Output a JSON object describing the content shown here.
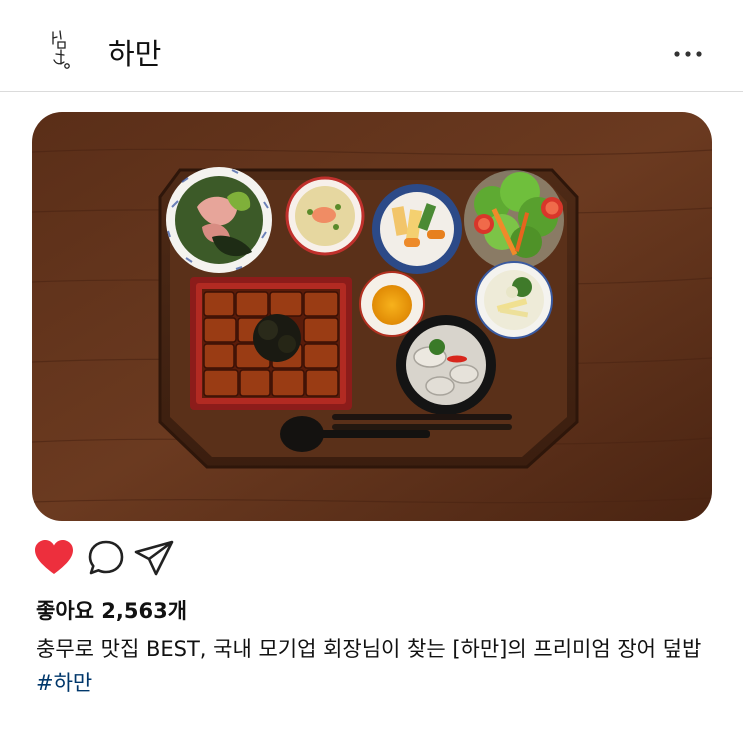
{
  "header": {
    "account_name": "하만",
    "more_icon": "more-horizontal-icon"
  },
  "post": {
    "image_alt_icon": "food-photo",
    "colors": {
      "like_red": "#ed2f3d",
      "hashtag_blue": "#00376b",
      "divider": "#dbdbdb"
    }
  },
  "actions": {
    "like_icon": "heart-filled-icon",
    "comment_icon": "comment-icon",
    "share_icon": "send-icon",
    "liked": true
  },
  "engagement": {
    "likes_text": "좋아요 2,563개"
  },
  "caption": {
    "text": "충무로 맛집 BEST, 국내 모기업 회장님이 찾는 [하만]의 프리미엄 장어 덮밥 ",
    "hashtag": "#하만"
  }
}
